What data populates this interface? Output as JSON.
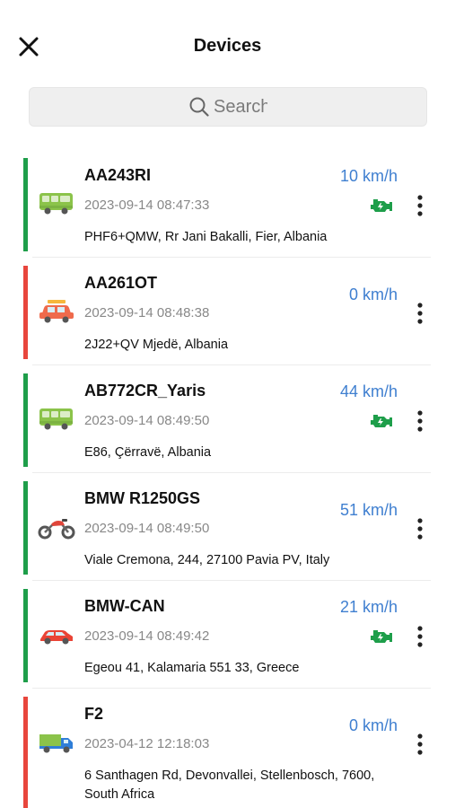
{
  "header": {
    "title": "Devices",
    "close_icon": "close-icon"
  },
  "search": {
    "placeholder": "Search",
    "value": "",
    "icon": "search-icon"
  },
  "colors": {
    "online": "#1e9e4a",
    "offline": "#e8463d",
    "speed": "#3f7fd0",
    "engine": "#1e9e4a"
  },
  "devices": [
    {
      "name": "AA243RI",
      "timestamp": "2023-09-14 08:47:33",
      "address": "PHF6+QMW, Rr Jani Bakalli, Fier, Albania",
      "speed": "10 km/h",
      "status": "online",
      "engine_on": true,
      "vehicle_icon": "bus-icon"
    },
    {
      "name": "AA261OT",
      "timestamp": "2023-09-14 08:48:38",
      "address": "2J22+QV Mjedë, Albania",
      "speed": "0 km/h",
      "status": "offline",
      "engine_on": false,
      "vehicle_icon": "taxi-icon"
    },
    {
      "name": "AB772CR_Yaris",
      "timestamp": "2023-09-14 08:49:50",
      "address": "E86, Çërravë, Albania",
      "speed": "44 km/h",
      "status": "online",
      "engine_on": true,
      "vehicle_icon": "bus-icon"
    },
    {
      "name": "BMW R1250GS",
      "timestamp": "2023-09-14 08:49:50",
      "address": "Viale Cremona, 244, 27100 Pavia PV, Italy",
      "speed": "51 km/h",
      "status": "online",
      "engine_on": false,
      "vehicle_icon": "motorcycle-icon"
    },
    {
      "name": "BMW-CAN",
      "timestamp": "2023-09-14 08:49:42",
      "address": "Egeou 41, Kalamaria 551 33, Greece",
      "speed": "21 km/h",
      "status": "online",
      "engine_on": true,
      "vehicle_icon": "car-icon"
    },
    {
      "name": "F2",
      "timestamp": "2023-04-12 12:18:03",
      "address": "6 Santhagen Rd, Devonvallei, Stellenbosch, 7600, South Africa",
      "speed": "0 km/h",
      "status": "offline",
      "engine_on": false,
      "vehicle_icon": "truck-icon"
    }
  ]
}
